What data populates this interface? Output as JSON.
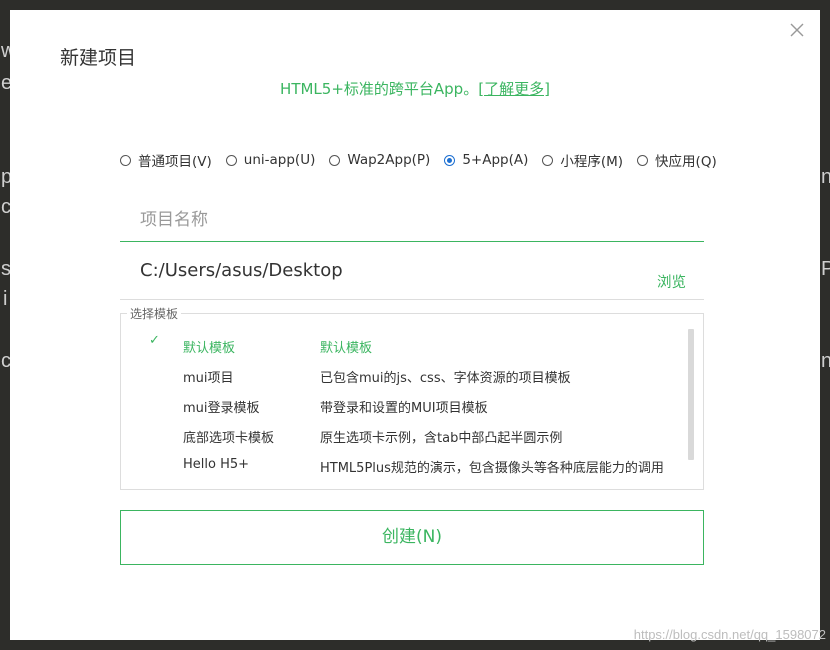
{
  "background_chars": [
    "w",
    "e",
    "p",
    "c",
    "s",
    "i",
    "c",
    "n",
    "P",
    "n"
  ],
  "dialog": {
    "title": "新建项目",
    "subtitle": "HTML5+标准的跨平台App。",
    "learn_more": "[了解更多]",
    "close_icon": "close-icon"
  },
  "project_types": [
    {
      "label": "普通项目(V)",
      "checked": false
    },
    {
      "label": "uni-app(U)",
      "checked": false
    },
    {
      "label": "Wap2App(P)",
      "checked": false
    },
    {
      "label": "5+App(A)",
      "checked": true
    },
    {
      "label": "小程序(M)",
      "checked": false
    },
    {
      "label": "快应用(Q)",
      "checked": false
    }
  ],
  "name_field": {
    "placeholder": "项目名称",
    "value": ""
  },
  "path": {
    "value": "C:/Users/asus/Desktop",
    "browse_label": "浏览"
  },
  "templates": {
    "legend": "选择模板",
    "items": [
      {
        "name": "默认模板",
        "desc": "默认模板",
        "selected": true
      },
      {
        "name": "mui项目",
        "desc": "已包含mui的js、css、字体资源的项目模板",
        "selected": false
      },
      {
        "name": "mui登录模板",
        "desc": "带登录和设置的MUI项目模板",
        "selected": false
      },
      {
        "name": "底部选项卡模板",
        "desc": "原生选项卡示例，含tab中部凸起半圆示例",
        "selected": false
      },
      {
        "name": "Hello H5+",
        "desc": "HTML5Plus规范的演示，包含摄像头等各种底层能力的调用",
        "selected": false
      }
    ]
  },
  "create_button": "创建(N)",
  "watermark": "https://blog.csdn.net/qq_1598072",
  "colors": {
    "accent": "#3bb560",
    "radio_checked": "#1c6fd1"
  }
}
